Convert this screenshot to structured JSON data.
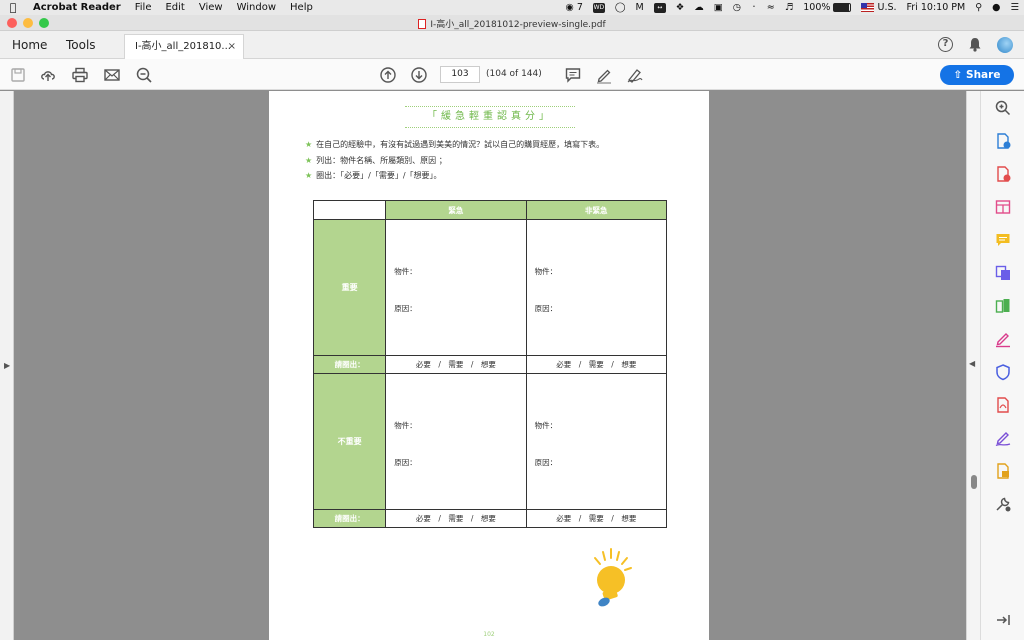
{
  "menubar": {
    "app_name": "Acrobat Reader",
    "menus": [
      "File",
      "Edit",
      "View",
      "Window",
      "Help"
    ],
    "wechat_count": "7",
    "battery_text": "100%",
    "input_source": "U.S.",
    "clock": "Fri 10:10 PM"
  },
  "window": {
    "title": "I-高小_all_20181012-preview-single.pdf"
  },
  "tabs": {
    "home": "Home",
    "tools": "Tools",
    "doc_tab": "I-高小_all_201810...",
    "close": "×"
  },
  "toolbar": {
    "page_number": "103",
    "page_count": "(104 of 144)",
    "share_label": "Share"
  },
  "page": {
    "title": "「緩急輕重認真分」",
    "bullet_star": "★",
    "bullets": [
      "在自己的經驗中，有沒有試過遇到美美的情況？試以自己的購買經歷，填寫下表。",
      "列出：物件名稱、所屬類別、原因 ；",
      "圈出：「必要」/「需要」/「想要」。"
    ],
    "col_urgent": "緊急",
    "col_not_urgent": "非緊急",
    "row_important": "重要",
    "row_not_important": "不重要",
    "item_label": "物件：",
    "reason_label": "原因：",
    "circle_label": "請圈出：",
    "options": "必要　/　需要　/　想要",
    "page_number": "102"
  },
  "colors": {
    "accent_green": "#b3d58f",
    "share_blue": "#1473e6",
    "bulb_yellow": "#f6c026"
  }
}
